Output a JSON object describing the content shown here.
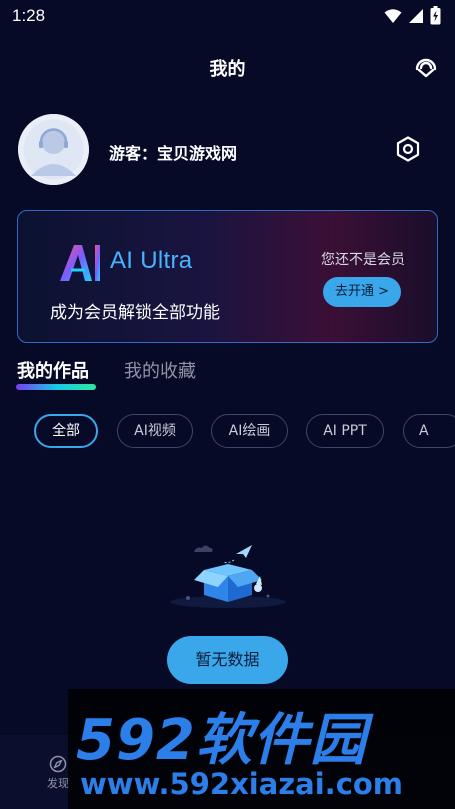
{
  "status_bar": {
    "time": "1:28"
  },
  "header": {
    "title": "我的"
  },
  "profile": {
    "username": "游客：宝贝游戏网"
  },
  "vip": {
    "brand": "AI Ultra",
    "description": "成为会员解锁全部功能",
    "notice": "您还不是会员",
    "open_button": "去开通 >"
  },
  "tabs": [
    {
      "label": "我的作品",
      "active": true
    },
    {
      "label": "我的收藏",
      "active": false
    }
  ],
  "filters": [
    {
      "label": "全部",
      "active": true
    },
    {
      "label": "AI视频",
      "active": false
    },
    {
      "label": "AI绘画",
      "active": false
    },
    {
      "label": "AI PPT",
      "active": false
    },
    {
      "label": "A",
      "active": false
    }
  ],
  "empty_state": {
    "label": "暂无数据"
  },
  "bottom_nav": {
    "discover_label": "发现"
  },
  "watermark": {
    "title": "592软件园",
    "url": "www.592xiazai.com"
  },
  "colors": {
    "accent": "#3aa7ea",
    "background": "#060a26",
    "brand_blue": "#48b4ff"
  }
}
